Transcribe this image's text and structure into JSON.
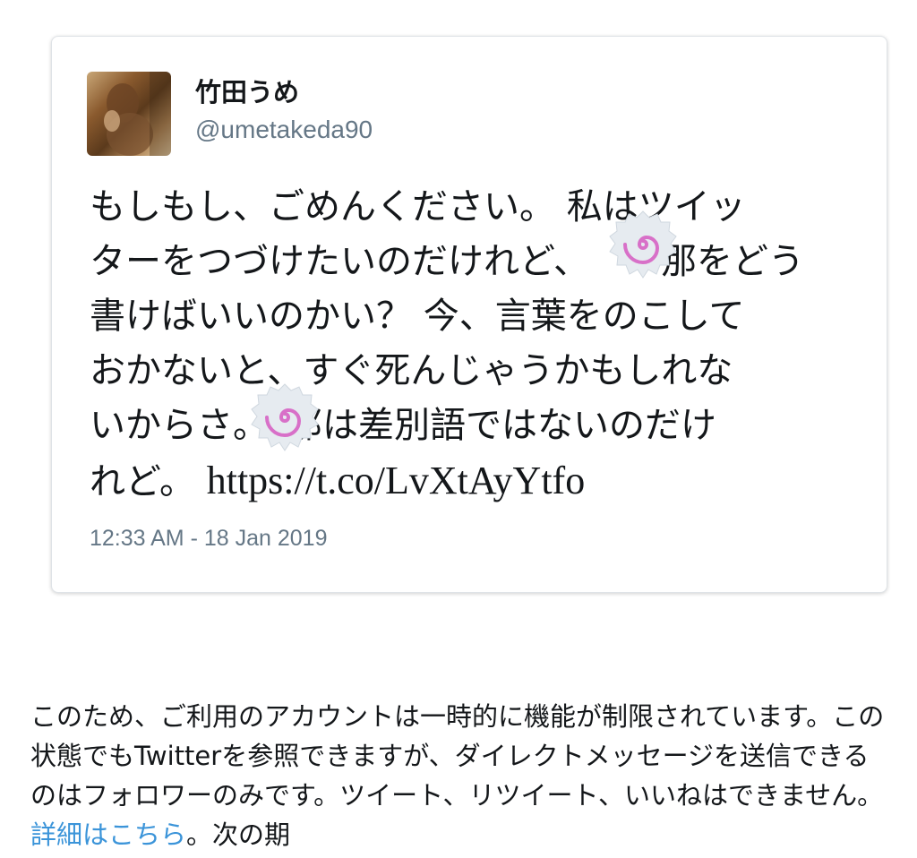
{
  "tweet": {
    "author_name": "竹田うめ",
    "author_handle": "@umetakeda90",
    "text_lines": [
      "もしもし、ごめんください。 私はツイッ",
      "ターをつづけたいのだけれど、",
      "那をどう",
      "書けばいいのかい？ 今、言葉をのこして",
      "おかないと、すぐ死んじゃうかもしれな",
      "いからさ。",
      "那は差別語ではないのだけ",
      "れど。"
    ],
    "link": "https://t.co/LvXtAyYtfo",
    "timestamp": "12:33 AM - 18 Jan 2019",
    "censor_icon": "naruto-swirl-icon"
  },
  "notice": {
    "text_before_link": "このため、ご利用のアカウントは一時的に機能が制限されています。この状態でもTwitterを参照できますが、ダイレクトメッセージを送信できるのはフォロワーのみです。ツイート、リツイート、いいねはできません。",
    "link_text": "詳細はこちら",
    "text_after_link": "。次の期"
  },
  "colors": {
    "secondary_text": "#657786",
    "link_blue": "#3b94d9",
    "swirl_pink": "#d870c8"
  }
}
